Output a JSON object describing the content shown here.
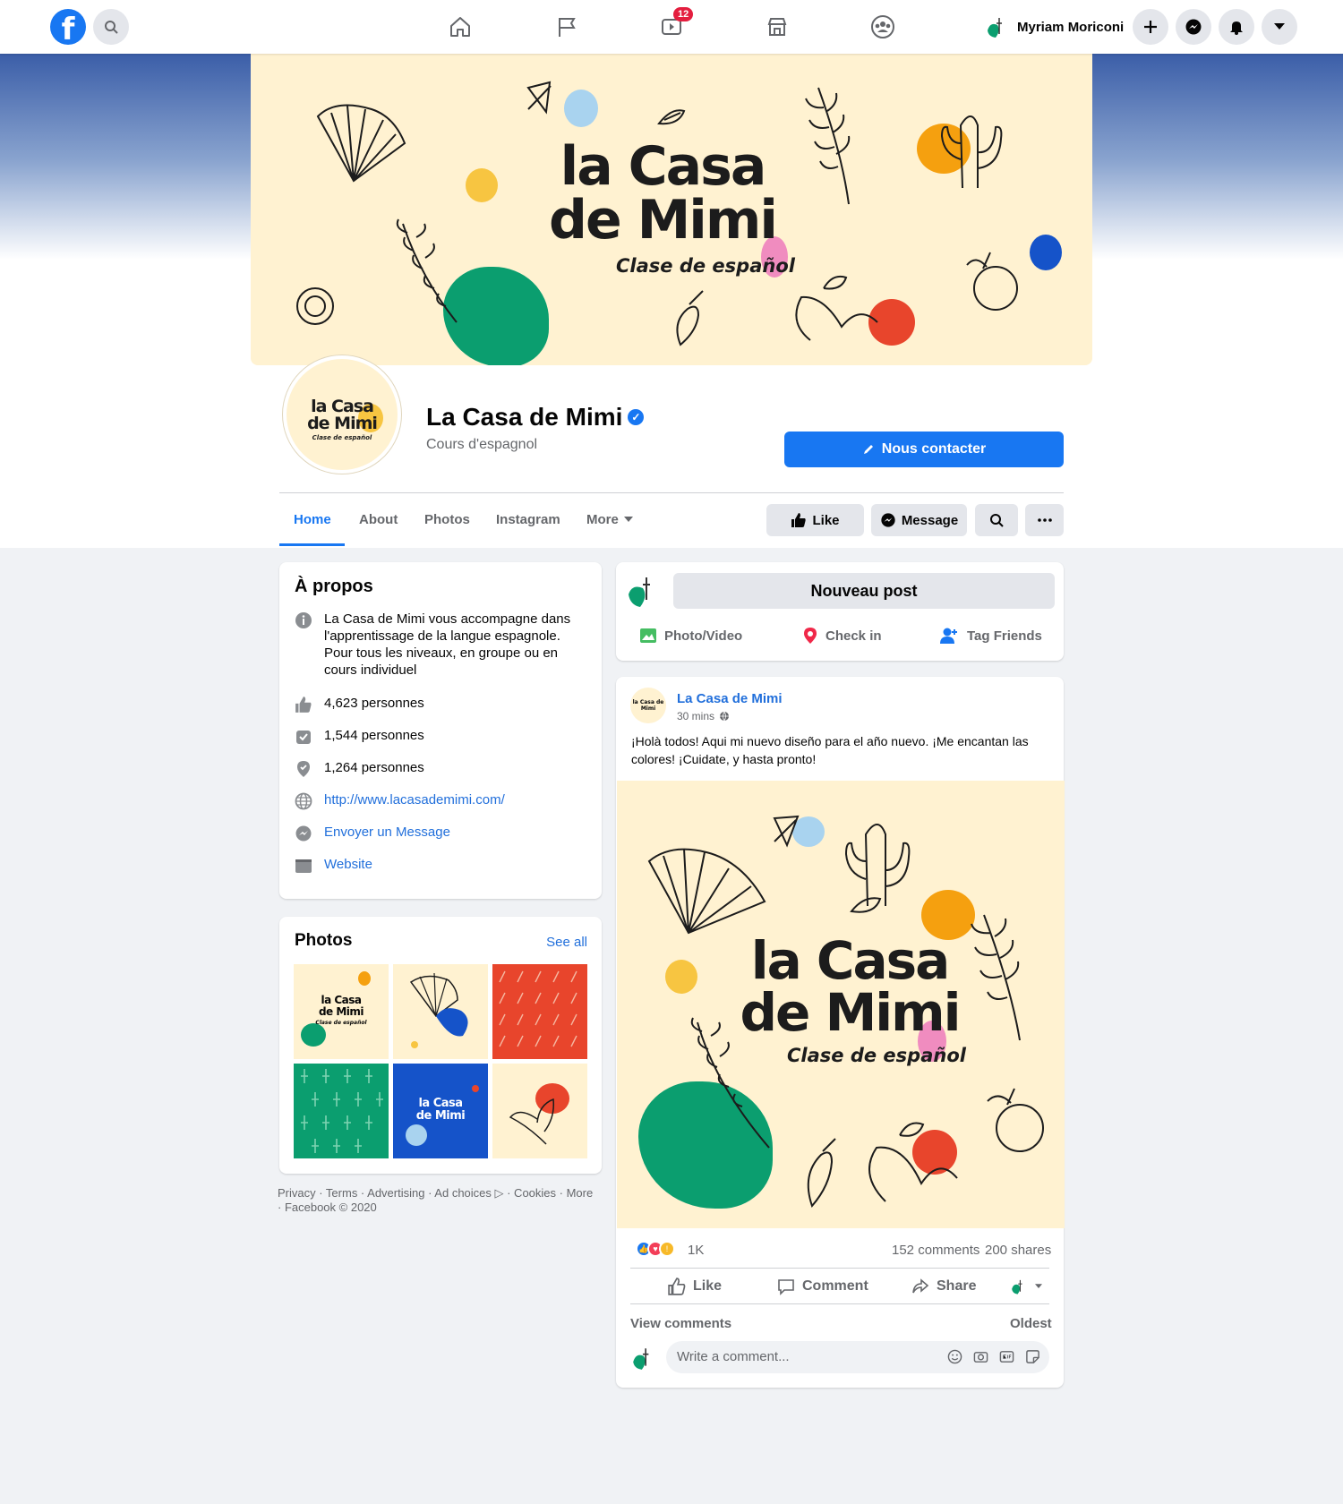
{
  "nav": {
    "user_name": "Myriam Moriconi",
    "watch_badge": "12",
    "icons": [
      "home-icon",
      "flag-icon",
      "watch-icon",
      "marketplace-icon",
      "groups-icon"
    ]
  },
  "cover": {
    "title_line1": "la Casa",
    "title_line2": "de Mimi",
    "subtitle": "Clase de español"
  },
  "profile": {
    "avatar_line1": "la Casa",
    "avatar_line2": "de Mimi",
    "avatar_sub": "Clase de español",
    "name": "La Casa de Mimi",
    "category": "Cours d'espagnol",
    "contact_label": "Nous contacter"
  },
  "tabs": [
    {
      "label": "Home",
      "active": true
    },
    {
      "label": "About"
    },
    {
      "label": "Photos"
    },
    {
      "label": "Instagram"
    },
    {
      "label": "More"
    }
  ],
  "actions": {
    "like": "Like",
    "message": "Message"
  },
  "about": {
    "title": "À propos",
    "description": "La Casa de Mimi vous accompagne dans l'apprentissage de la langue espagnole. Pour tous les niveaux, en groupe ou en cours individuel",
    "likes": "4,623 personnes",
    "follows": "1,544 personnes",
    "checkins": "1,264 personnes",
    "website_url": "http://www.lacasademimi.com/",
    "message_link": "Envoyer un Message",
    "website_label": "Website"
  },
  "photos": {
    "title": "Photos",
    "see_all": "See all",
    "tile1_line1": "la Casa",
    "tile1_line2": "de Mimi",
    "tile1_sub": "Clase de español",
    "tile5_line1": "la Casa",
    "tile5_line2": "de Mimi"
  },
  "footer": {
    "links": "Privacy · Terms · Advertising · Ad choices ▷ · Cookies · More · Facebook © 2020"
  },
  "composer": {
    "button": "Nouveau post",
    "photo_video": "Photo/Video",
    "check_in": "Check in",
    "tag_friends": "Tag Friends"
  },
  "post": {
    "author": "La Casa de Mimi",
    "time": "30 mins",
    "avatar_text": "la Casa de Mimi",
    "text": "¡Holà todos! Aqui mi nuevo diseño para el año nuevo. ¡Me encantan las colores! ¡Cuidate, y hasta pronto!",
    "image_line1": "la Casa",
    "image_line2": "de Mimi",
    "image_sub": "Clase de español",
    "reactions": "1K",
    "comments": "152 comments",
    "shares": "200 shares",
    "like": "Like",
    "comment": "Comment",
    "share": "Share",
    "view_comments": "View comments",
    "oldest": "Oldest",
    "comment_placeholder": "Write a comment..."
  },
  "colors": {
    "fb_blue": "#1877f2",
    "cream": "#fff2d1",
    "green": "#0b9e6f",
    "orange": "#f5a00f",
    "yellow": "#f7c541",
    "red": "#e8452c",
    "pink": "#f08cbf",
    "light_blue": "#a9d3ef",
    "navy": "#1553c9"
  }
}
